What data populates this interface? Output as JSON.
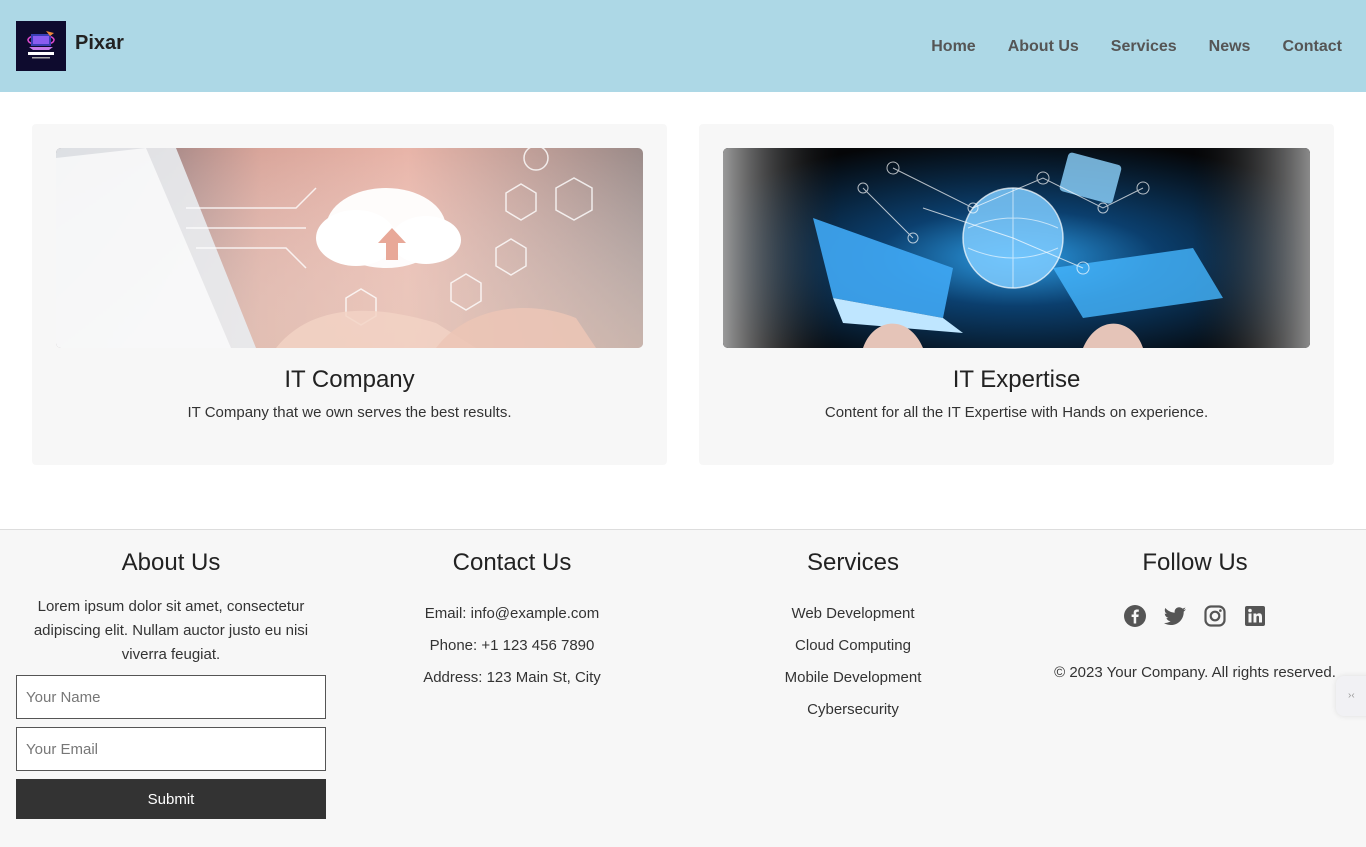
{
  "header": {
    "brand_name": "Pixar",
    "logo_text": "COMPUTER",
    "nav": [
      "Home",
      "About Us",
      "Services",
      "News",
      "Contact"
    ]
  },
  "cards": [
    {
      "title": "IT Company",
      "description": "IT Company that we own serves the best results."
    },
    {
      "title": "IT Expertise",
      "description": "Content for all the IT Expertise with Hands on experience."
    }
  ],
  "footer": {
    "about": {
      "heading": "About Us",
      "text": "Lorem ipsum dolor sit amet, consectetur adipiscing elit. Nullam auctor justo eu nisi viverra feugiat.",
      "name_placeholder": "Your Name",
      "email_placeholder": "Your Email",
      "submit_label": "Submit"
    },
    "contact": {
      "heading": "Contact Us",
      "lines": [
        "Email: info@example.com",
        "Phone: +1 123 456 7890",
        "Address: 123 Main St, City"
      ]
    },
    "services": {
      "heading": "Services",
      "items": [
        "Web Development",
        "Cloud Computing",
        "Mobile Development",
        "Cybersecurity"
      ]
    },
    "follow": {
      "heading": "Follow Us",
      "icons": [
        "facebook-icon",
        "twitter-icon",
        "instagram-icon",
        "linkedin-icon"
      ],
      "copyright": "© 2023 Your Company. All rights reserved."
    }
  },
  "colors": {
    "header_bg": "#add8e6",
    "card_bg": "#f7f7f7",
    "footer_bg": "#f7f7f7",
    "button_bg": "#333333"
  }
}
